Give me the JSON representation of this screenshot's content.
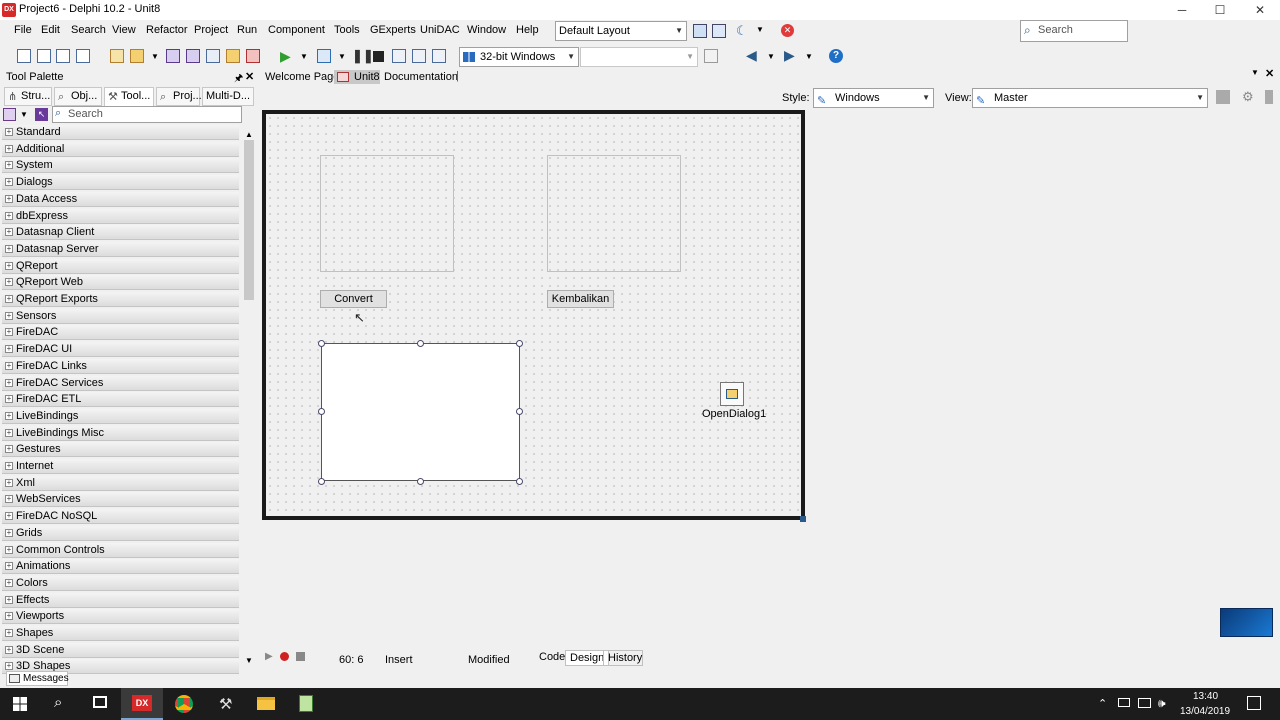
{
  "window": {
    "title": "Project6 - Delphi 10.2 - Unit8",
    "controls": {
      "minimize": "─",
      "maximize": "☐",
      "close": "✕"
    }
  },
  "menu": [
    "File",
    "Edit",
    "Search",
    "View",
    "Refactor",
    "Project",
    "Run",
    "Component",
    "Tools",
    "GExperts",
    "UniDAC",
    "Window",
    "Help"
  ],
  "layout_combo": "Default Layout",
  "search_placeholder": "Search",
  "platform_combo": "32-bit Windows",
  "tool_palette": {
    "title": "Tool Palette",
    "tabs": [
      "Stru...",
      "Obj...",
      "Tool...",
      "Proj...",
      "Multi-D..."
    ],
    "search_placeholder": "Search",
    "categories": [
      "Standard",
      "Additional",
      "System",
      "Dialogs",
      "Data Access",
      "dbExpress",
      "Datasnap Client",
      "Datasnap Server",
      "QReport",
      "QReport Web",
      "QReport Exports",
      "Sensors",
      "FireDAC",
      "FireDAC UI",
      "FireDAC Links",
      "FireDAC Services",
      "FireDAC ETL",
      "LiveBindings",
      "LiveBindings Misc",
      "Gestures",
      "Internet",
      "Xml",
      "WebServices",
      "FireDAC NoSQL",
      "Grids",
      "Common Controls",
      "Animations",
      "Colors",
      "Effects",
      "Viewports",
      "Shapes",
      "3D Scene",
      "3D Shapes"
    ]
  },
  "editor_tabs": [
    "Welcome Page",
    "Unit8",
    "Documentation"
  ],
  "style_label": "Style:",
  "style_value": "Windows",
  "view_label": "View:",
  "view_value": "Master",
  "form": {
    "convert_button": "Convert",
    "kembalikan_button": "Kembalikan",
    "dialog_label": "OpenDialog1"
  },
  "status": {
    "position": "60:  6",
    "mode": "Insert",
    "state": "Modified",
    "tabs": [
      "Code",
      "Design",
      "History"
    ]
  },
  "messages_tab": "Messages",
  "taskbar": {
    "time": "13:40",
    "date": "13/04/2019"
  },
  "colors": {
    "accent": "#0078d7",
    "delphi_red": "#d62a2a"
  }
}
